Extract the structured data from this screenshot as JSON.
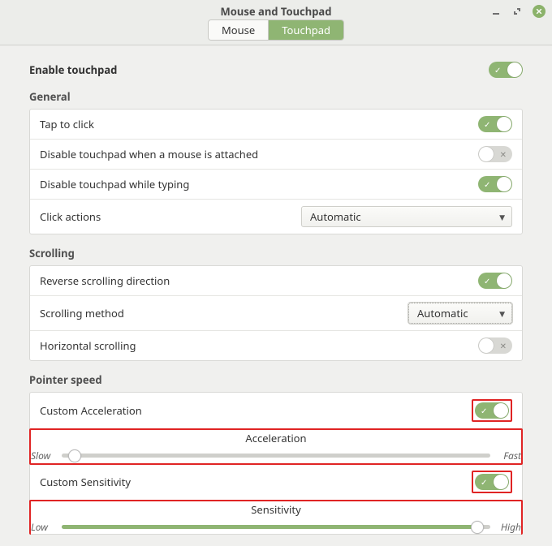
{
  "window": {
    "title": "Mouse and Touchpad",
    "tabs": {
      "mouse": "Mouse",
      "touchpad": "Touchpad"
    }
  },
  "enable_label": "Enable touchpad",
  "general": {
    "title": "General",
    "tap_to_click": "Tap to click",
    "disable_when_mouse": "Disable touchpad when a mouse is attached",
    "disable_while_typing": "Disable touchpad while typing",
    "click_actions_label": "Click actions",
    "click_actions_value": "Automatic"
  },
  "scrolling": {
    "title": "Scrolling",
    "reverse": "Reverse scrolling direction",
    "method_label": "Scrolling method",
    "method_value": "Automatic",
    "horizontal": "Horizontal scrolling"
  },
  "pointer": {
    "title": "Pointer speed",
    "custom_accel": "Custom Acceleration",
    "accel_heading": "Acceleration",
    "accel_low": "Slow",
    "accel_high": "Fast",
    "custom_sens": "Custom Sensitivity",
    "sens_heading": "Sensitivity",
    "sens_low": "Low",
    "sens_high": "High"
  }
}
